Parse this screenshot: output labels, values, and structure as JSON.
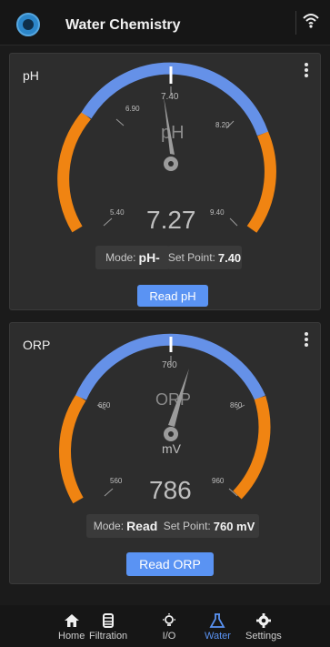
{
  "header": {
    "title": "Water Chemistry",
    "logo_icon": "app-logo-icon",
    "status_icon": "wifi-icon"
  },
  "ph": {
    "title": "pH",
    "unit_label": "pH",
    "current_value": "7.27",
    "set_point_value": 7.4,
    "min": 5.4,
    "max": 9.4,
    "ticks": [
      "5.40",
      "6.90",
      "7.40",
      "8.20",
      "9.40"
    ],
    "mode_label": "Mode:",
    "mode_value": "pH-",
    "setpoint_label": "Set Point:",
    "setpoint_value": "7.40",
    "read_button": "Read pH",
    "accent_blue": "#6591e8",
    "accent_orange": "#f08412"
  },
  "orp": {
    "title": "ORP",
    "unit_label": "ORP",
    "unit_sub": "mV",
    "current_value": "786",
    "set_point_value": 760,
    "min": 560,
    "max": 960,
    "ticks": [
      "560",
      "660",
      "760",
      "860",
      "960"
    ],
    "mode_label": "Mode:",
    "mode_value": "Read",
    "setpoint_label": "Set Point:",
    "setpoint_value": "760 mV",
    "read_button": "Read ORP",
    "accent_blue": "#6591e8",
    "accent_orange": "#f08412"
  },
  "nav": {
    "items": [
      {
        "label": "Home",
        "icon": "home-icon"
      },
      {
        "label": "Filtration",
        "icon": "filter-icon"
      },
      {
        "label": "I/O",
        "icon": "lightbulb-icon"
      },
      {
        "label": "Water",
        "icon": "flask-icon",
        "active": true
      },
      {
        "label": "Settings",
        "icon": "gear-icon"
      }
    ]
  }
}
